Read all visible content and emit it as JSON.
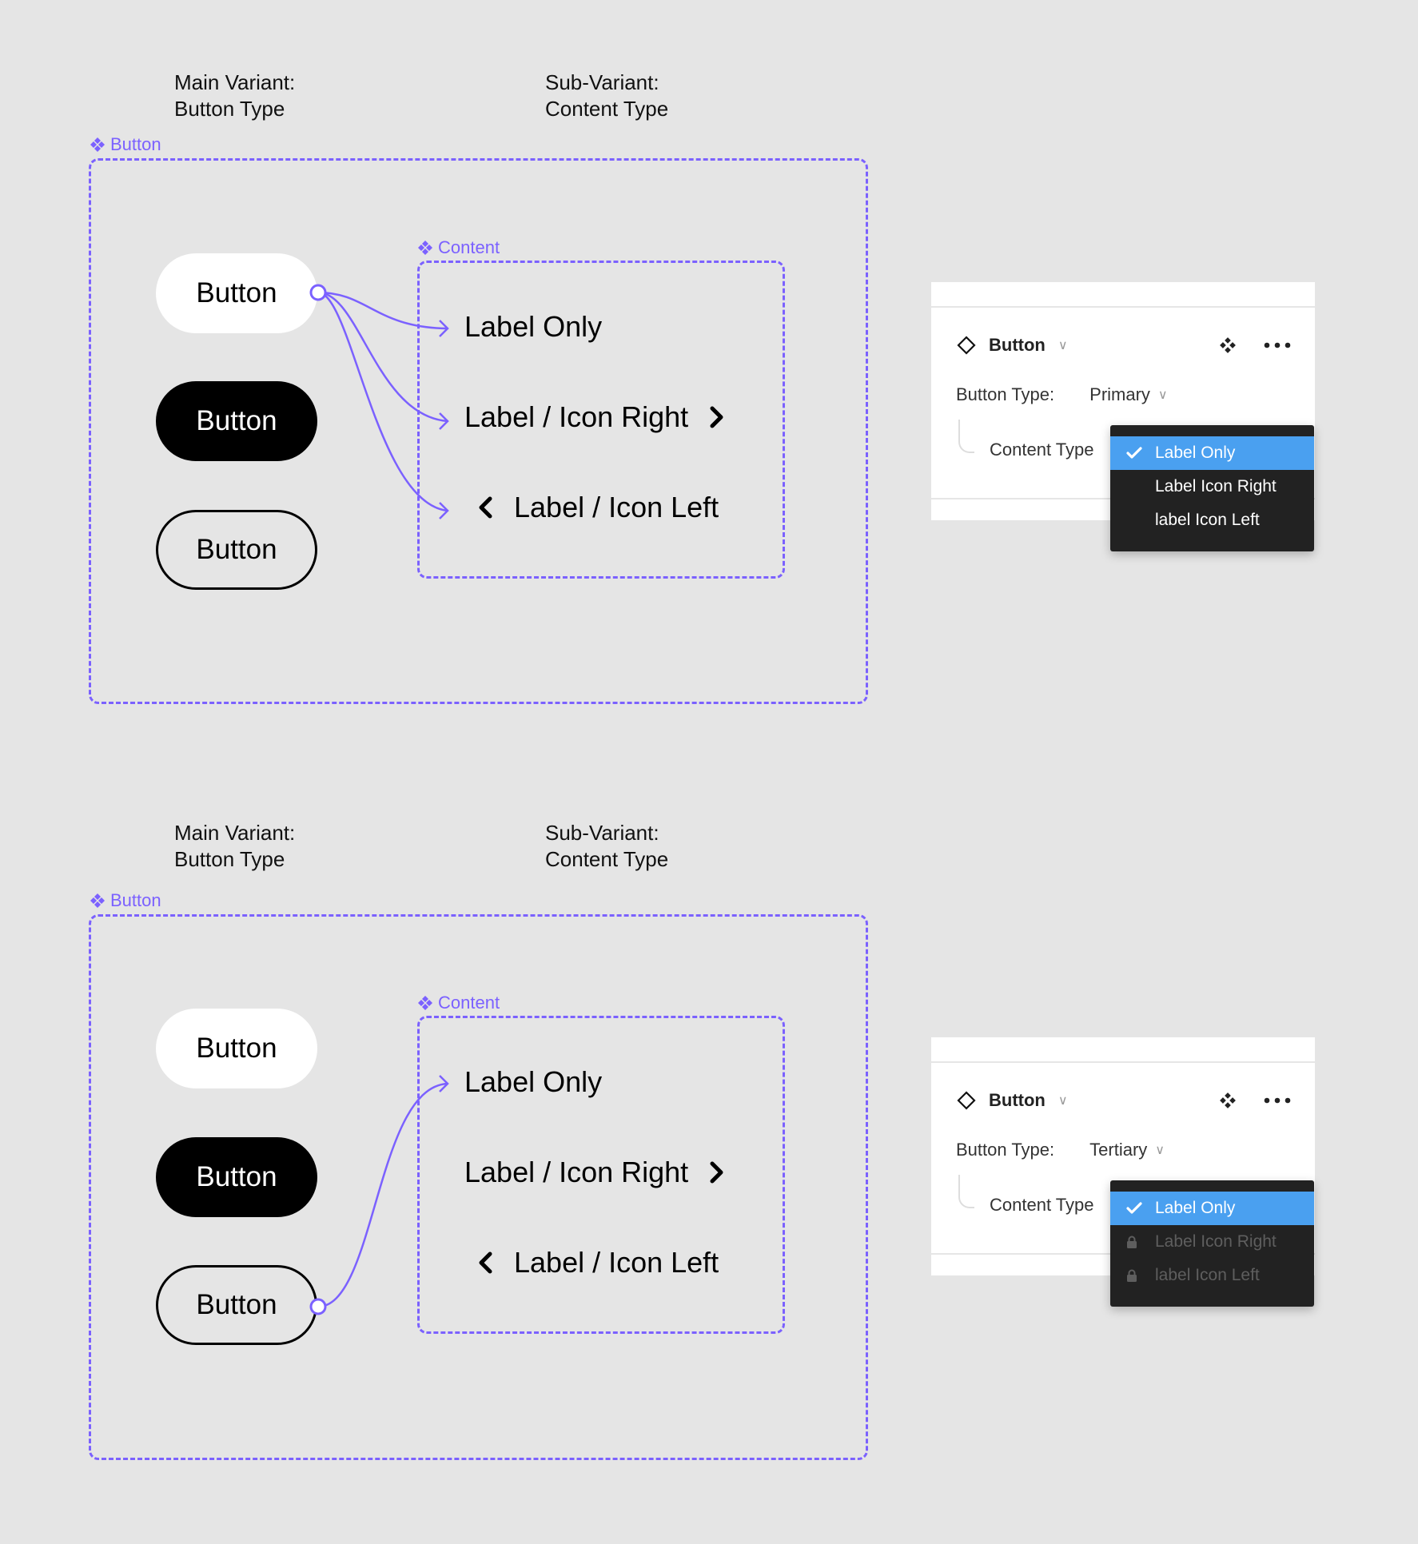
{
  "sections": [
    {
      "heading_main": [
        "Main Variant:",
        "Button Type"
      ],
      "heading_sub": [
        "Sub-Variant:",
        "Content Type"
      ],
      "outer_frame_label": "Button",
      "inner_frame_label": "Content",
      "buttons": [
        {
          "type": "primary",
          "label": "Button"
        },
        {
          "type": "secondary",
          "label": "Button"
        },
        {
          "type": "tertiary",
          "label": "Button"
        }
      ],
      "content_items": [
        {
          "label": "Label Only",
          "icon": "none"
        },
        {
          "label": "Label / Icon Right",
          "icon": "chevron-right-icon"
        },
        {
          "label": "Label / Icon Left",
          "icon": "chevron-left-icon"
        }
      ],
      "connections": {
        "from_button": "primary",
        "to_items": [
          "Label Only",
          "Label / Icon Right",
          "Label / Icon Left"
        ]
      },
      "panel": {
        "component_name": "Button",
        "button_type_label": "Button Type:",
        "button_type_value": "Primary",
        "content_type_label": "Content Type",
        "dropdown_options": [
          {
            "label": "Label Only",
            "state": "selected"
          },
          {
            "label": "Label Icon Right",
            "state": "enabled"
          },
          {
            "label": "label Icon Left",
            "state": "enabled"
          }
        ]
      }
    },
    {
      "heading_main": [
        "Main Variant:",
        "Button Type"
      ],
      "heading_sub": [
        "Sub-Variant:",
        "Content Type"
      ],
      "outer_frame_label": "Button",
      "inner_frame_label": "Content",
      "buttons": [
        {
          "type": "primary",
          "label": "Button"
        },
        {
          "type": "secondary",
          "label": "Button"
        },
        {
          "type": "tertiary",
          "label": "Button"
        }
      ],
      "content_items": [
        {
          "label": "Label Only",
          "icon": "none"
        },
        {
          "label": "Label / Icon Right",
          "icon": "chevron-right-icon"
        },
        {
          "label": "Label / Icon Left",
          "icon": "chevron-left-icon"
        }
      ],
      "connections": {
        "from_button": "tertiary",
        "to_items": [
          "Label Only"
        ]
      },
      "panel": {
        "component_name": "Button",
        "button_type_label": "Button Type:",
        "button_type_value": "Tertiary",
        "content_type_label": "Content Type",
        "dropdown_options": [
          {
            "label": "Label Only",
            "state": "selected"
          },
          {
            "label": "Label Icon Right",
            "state": "locked"
          },
          {
            "label": "label Icon Left",
            "state": "locked"
          }
        ]
      }
    }
  ],
  "colors": {
    "accent": "#7b61ff",
    "canvas": "#e5e5e5",
    "dropdown_bg": "#222222",
    "dropdown_selected": "#4aa0f0",
    "dropdown_disabled_text": "#5e5e5e"
  }
}
